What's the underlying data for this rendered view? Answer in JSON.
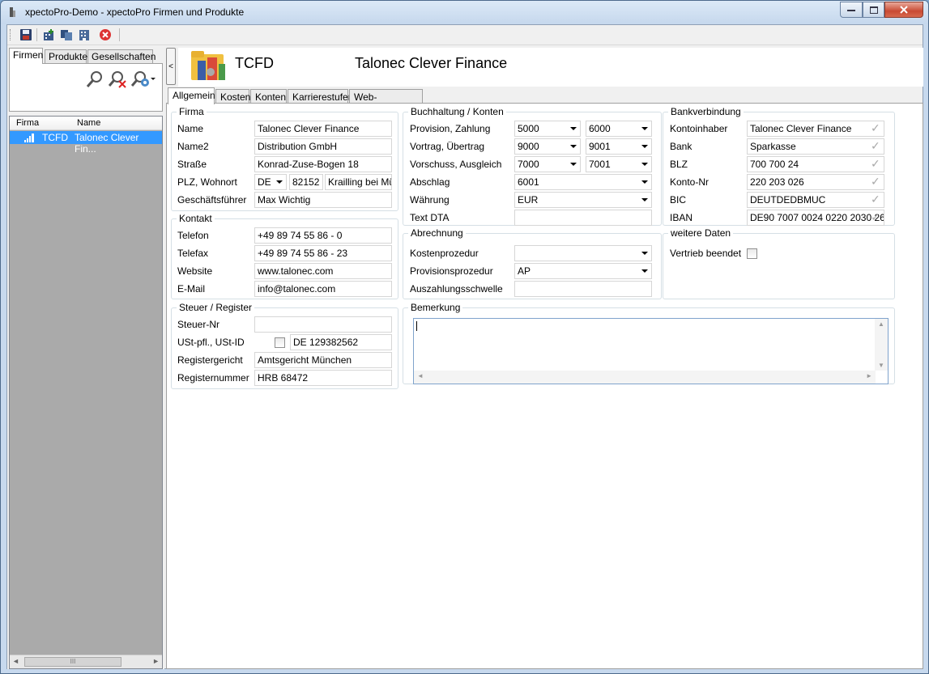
{
  "window": {
    "title": "xpectoPro-Demo - xpectoPro Firmen und Produkte"
  },
  "toolbar": {
    "icons": [
      "save-icon",
      "company-add-icon",
      "copy-icon",
      "building-icon",
      "delete-icon"
    ]
  },
  "left": {
    "tabs": [
      {
        "label": "Firmen",
        "active": true
      },
      {
        "label": "Produkte",
        "active": false
      },
      {
        "label": "Gesellschaften",
        "active": false
      }
    ],
    "list": {
      "headers": [
        "Firma",
        "Name"
      ],
      "rows": [
        {
          "firma": "TCFD",
          "name": "Talonec Clever Fin...",
          "selected": true
        }
      ],
      "scroll_left": "◄",
      "scroll_thumb": "III",
      "scroll_right": "►"
    }
  },
  "collapse_label": "<",
  "header": {
    "code": "TCFD",
    "name": "Talonec Clever Finance"
  },
  "tabs": [
    {
      "label": "Allgemein",
      "active": true
    },
    {
      "label": "Kosten"
    },
    {
      "label": "Konten"
    },
    {
      "label": "Karrierestufen"
    },
    {
      "label": "Web-Dokumente"
    }
  ],
  "firma": {
    "legend": "Firma",
    "name_label": "Name",
    "name": "Talonec Clever Finance",
    "name2_label": "Name2",
    "name2": "Distribution GmbH",
    "strasse_label": "Straße",
    "strasse": "Konrad-Zuse-Bogen 18",
    "plz_label": "PLZ, Wohnort",
    "country": "DE",
    "plz": "82152",
    "ort": "Krailling bei Mün",
    "gf_label": "Geschäftsführer",
    "gf": "Max Wichtig"
  },
  "kontakt": {
    "legend": "Kontakt",
    "telefon_label": "Telefon",
    "telefon": "+49 89 74 55 86 - 0",
    "telefax_label": "Telefax",
    "telefax": "+49 89 74 55 86 - 23",
    "website_label": "Website",
    "website": "www.talonec.com",
    "email_label": "E-Mail",
    "email": "info@talonec.com"
  },
  "steuer": {
    "legend": "Steuer / Register",
    "steuernr_label": "Steuer-Nr",
    "steuernr": "",
    "ust_label": "USt-pfl., USt-ID",
    "ust_checked": false,
    "ustid": "DE 129382562",
    "regger_label": "Registergericht",
    "regger": "Amtsgericht München",
    "regnr_label": "Registernummer",
    "regnr": "HRB 68472"
  },
  "buchhaltung": {
    "legend": "Buchhaltung / Konten",
    "provision_label": "Provision, Zahlung",
    "provision": "5000",
    "zahlung": "6000",
    "vortrag_label": "Vortrag, Übertrag",
    "vortrag": "9000",
    "uebertrag": "9001",
    "vorschuss_label": "Vorschuss, Ausgleich",
    "vorschuss": "7000",
    "ausgleich": "7001",
    "abschlag_label": "Abschlag",
    "abschlag": "6001",
    "waehrung_label": "Währung",
    "waehrung": "EUR",
    "textdta_label": "Text DTA",
    "textdta": ""
  },
  "abrechnung": {
    "legend": "Abrechnung",
    "kosten_label": "Kostenprozedur",
    "kosten": "",
    "provision_label": "Provisionsprozedur",
    "provision": "AP",
    "schwelle_label": "Auszahlungsschwelle",
    "schwelle": ""
  },
  "bank": {
    "legend": "Bankverbindung",
    "inhaber_label": "Kontoinhaber",
    "inhaber": "Talonec Clever Finance",
    "bank_label": "Bank",
    "bank": "Sparkasse",
    "blz_label": "BLZ",
    "blz": "700 700 24",
    "konto_label": "Konto-Nr",
    "konto": "220 203 026",
    "bic_label": "BIC",
    "bic": "DEUTDEDBMUC",
    "iban_label": "IBAN",
    "iban": "DE90 7007 0024 0220 2030 26"
  },
  "weitere": {
    "legend": "weitere Daten",
    "vertrieb_label": "Vertrieb beendet",
    "vertrieb_checked": false
  },
  "bemerkung": {
    "legend": "Bemerkung",
    "text": "",
    "scroll_up": "▲",
    "scroll_down": "▼",
    "scroll_left": "◄",
    "scroll_right": "►"
  },
  "check_glyph": "✓",
  "colors": {
    "selection": "#3399ff",
    "titlebar": "#c6d8ed",
    "close": "#c94a33"
  }
}
